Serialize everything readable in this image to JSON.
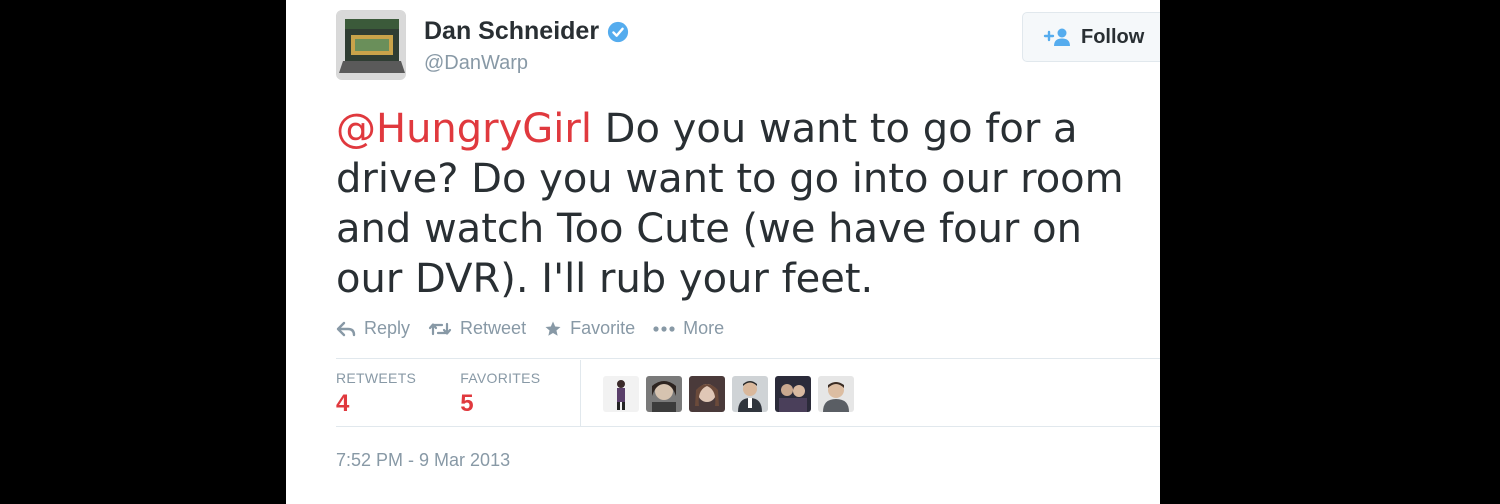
{
  "tweet": {
    "author_name": "Dan Schneider",
    "author_handle": "@DanWarp",
    "follow_label": "Follow",
    "mention": "@HungryGirl",
    "body": " Do you want to go for a drive? Do you want to go into our room and watch Too Cute (we have four on our DVR). I'll rub your feet.",
    "actions": {
      "reply": "Reply",
      "retweet": "Retweet",
      "favorite": "Favorite",
      "more": "More"
    },
    "stats": {
      "retweets_label": "RETWEETS",
      "retweets_count": "4",
      "favorites_label": "FAVORITES",
      "favorites_count": "5"
    },
    "timestamp": "7:52 PM - 9 Mar 2013"
  },
  "colors": {
    "mention": "#e0393e",
    "muted": "#8899a6",
    "text": "#292f33",
    "verified": "#55acee",
    "background": "#000000"
  },
  "icons": {
    "verified": "verified-badge-icon",
    "follow": "person-add-icon",
    "reply": "reply-arrow-icon",
    "retweet": "retweet-icon",
    "favorite": "star-icon",
    "more": "ellipsis-icon"
  }
}
